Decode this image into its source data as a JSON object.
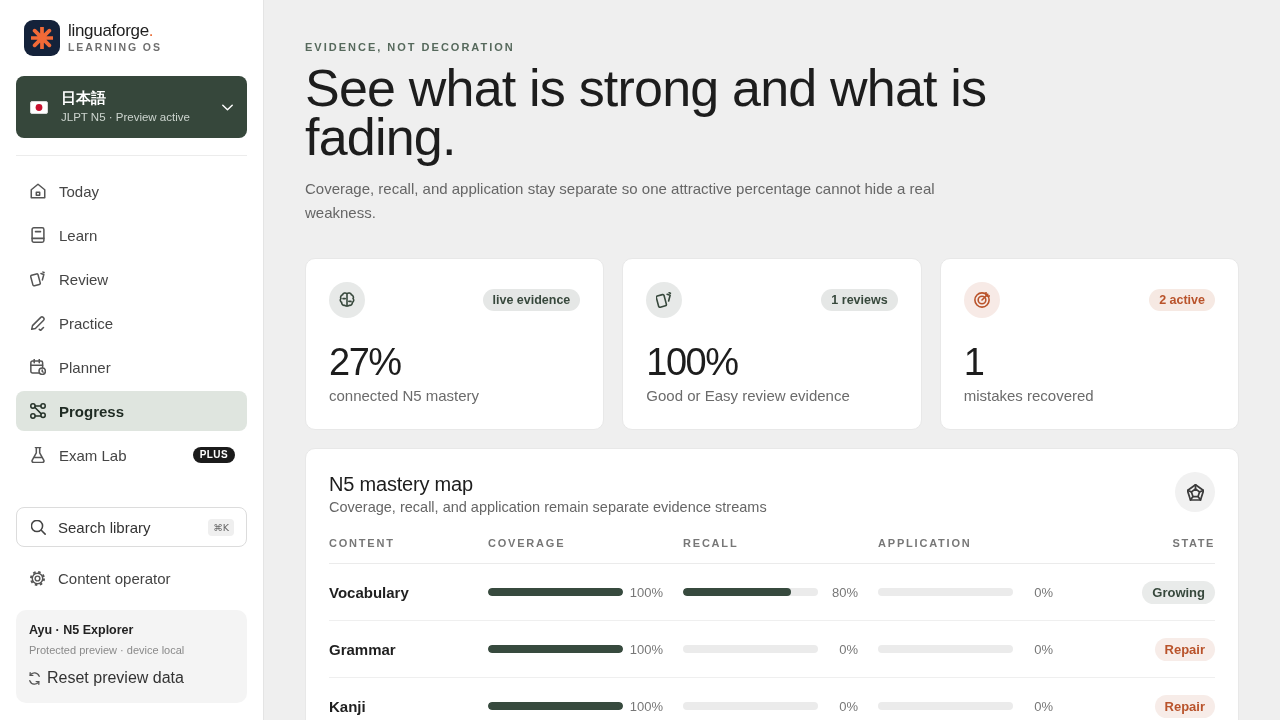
{
  "brand": {
    "name": "linguaforge",
    "accent": ".",
    "tagline": "LEARNING OS"
  },
  "course_switcher": {
    "language": "日本語",
    "status": "JLPT N5 · Preview active"
  },
  "nav": [
    {
      "label": "Today",
      "selected": false
    },
    {
      "label": "Learn",
      "selected": false
    },
    {
      "label": "Review",
      "selected": false
    },
    {
      "label": "Practice",
      "selected": false
    },
    {
      "label": "Planner",
      "selected": false
    },
    {
      "label": "Progress",
      "selected": true
    },
    {
      "label": "Exam Lab",
      "selected": false,
      "badge": "PLUS"
    }
  ],
  "search": {
    "placeholder": "Search library",
    "shortcut": "⌘K"
  },
  "operator_link": {
    "label": "Content operator"
  },
  "profile": {
    "name": "Ayu · N5 Explorer",
    "note": "Protected preview · device local",
    "reset_label": "Reset preview data"
  },
  "header": {
    "eyebrow": "EVIDENCE, NOT DECORATION",
    "title": "See what is strong and what is fading.",
    "lede": "Coverage, recall, and application stay separate so one attractive percentage cannot hide a real weakness."
  },
  "stats": [
    {
      "badge": "live evidence",
      "color": "#37483c",
      "value": "27%",
      "label": "connected N5 mastery"
    },
    {
      "badge": "1 reviews",
      "color": "#37483c",
      "value": "100%",
      "label": "Good or Easy review evidence"
    },
    {
      "badge": "2 active",
      "color": "#b9532b",
      "value": "1",
      "label": "mistakes recovered"
    }
  ],
  "mastery_map": {
    "title": "N5 mastery map",
    "subtitle": "Coverage, recall, and application remain separate evidence streams",
    "columns": [
      "CONTENT",
      "COVERAGE",
      "RECALL",
      "APPLICATION",
      "STATE"
    ],
    "rows": [
      {
        "content": "Vocabulary",
        "coverage": {
          "level": 1,
          "reading": "100%"
        },
        "recall": {
          "level": 0.8,
          "reading": "80%"
        },
        "application": {
          "level": 0,
          "reading": "0%"
        },
        "state": {
          "label": "Growing",
          "color": "#37483c"
        }
      },
      {
        "content": "Grammar",
        "coverage": {
          "level": 1,
          "reading": "100%"
        },
        "recall": {
          "level": 0,
          "reading": "0%"
        },
        "application": {
          "level": 0,
          "reading": "0%"
        },
        "state": {
          "label": "Repair",
          "color": "#b9532b"
        }
      },
      {
        "content": "Kanji",
        "coverage": {
          "level": 1,
          "reading": "100%"
        },
        "recall": {
          "level": 0,
          "reading": "0%"
        },
        "application": {
          "level": 0,
          "reading": "0%"
        },
        "state": {
          "label": "Repair",
          "color": "#b9532b"
        }
      }
    ]
  }
}
